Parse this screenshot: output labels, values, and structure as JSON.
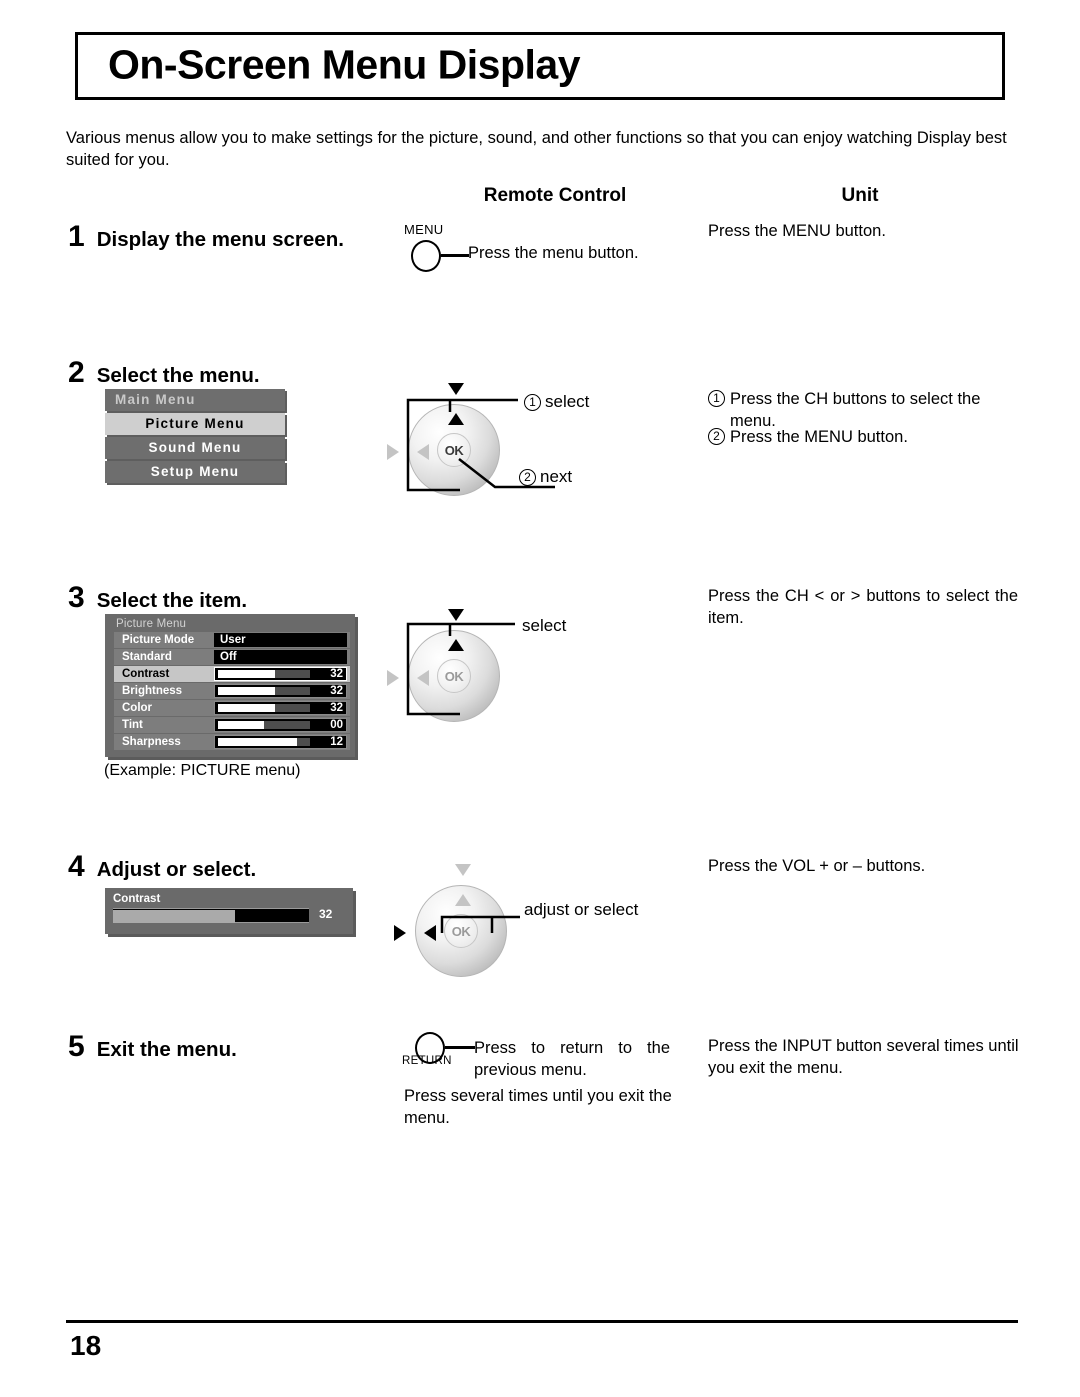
{
  "page": {
    "title": "On-Screen Menu Display",
    "intro": "Various menus allow you to make settings for the picture, sound, and other functions so that you can enjoy watching Display best suited for you.",
    "number": "18"
  },
  "columns": {
    "remote_control": "Remote Control",
    "unit": "Unit"
  },
  "steps": [
    {
      "number": "1",
      "title": "Display the menu screen.",
      "remote": {
        "button_label": "MENU",
        "instruction": "Press the menu button."
      },
      "unit": "Press the MENU button."
    },
    {
      "number": "2",
      "title": "Select the menu.",
      "remote": {
        "callout_1_num": "1",
        "callout_1_label": "select",
        "callout_2_num": "2",
        "callout_2_label": "next",
        "ok_label": "OK"
      },
      "unit_1_num": "1",
      "unit_1": "Press the CH buttons to select the menu.",
      "unit_2_num": "2",
      "unit_2": "Press the MENU button."
    },
    {
      "number": "3",
      "title": "Select the item.",
      "remote": {
        "callout_label": "select",
        "ok_label": "OK"
      },
      "unit": "Press the CH < or > buttons to select the item.",
      "caption": "(Example: PICTURE menu)"
    },
    {
      "number": "4",
      "title": "Adjust or select.",
      "remote": {
        "callout_label": "adjust or select",
        "ok_label": "OK"
      },
      "unit": "Press the VOL + or – buttons."
    },
    {
      "number": "5",
      "title": "Exit the menu.",
      "remote": {
        "button_label": "RETURN",
        "instruction": "Press to return to the previous menu.",
        "extra": "Press several times until you exit the menu."
      },
      "unit": "Press the INPUT button several times until you exit the menu."
    }
  ],
  "osd_main_menu": {
    "header": "Main Menu",
    "items": [
      {
        "label": "Picture Menu",
        "selected": true
      },
      {
        "label": "Sound Menu",
        "selected": false
      },
      {
        "label": "Setup Menu",
        "selected": false
      }
    ]
  },
  "osd_picture_menu": {
    "title": "Picture Menu",
    "rows": [
      {
        "label": "Picture Mode",
        "type": "text",
        "value": "User",
        "selected": false
      },
      {
        "label": "Standard",
        "type": "text",
        "value": "Off",
        "selected": false
      },
      {
        "label": "Contrast",
        "type": "slider",
        "value": "32",
        "fill_pct": 62,
        "selected": true
      },
      {
        "label": "Brightness",
        "type": "slider",
        "value": "32",
        "fill_pct": 62,
        "selected": false
      },
      {
        "label": "Color",
        "type": "slider",
        "value": "32",
        "fill_pct": 62,
        "selected": false
      },
      {
        "label": "Tint",
        "type": "slider",
        "value": "00",
        "fill_pct": 50,
        "selected": false
      },
      {
        "label": "Sharpness",
        "type": "slider",
        "value": "12",
        "fill_pct": 86,
        "selected": false
      }
    ]
  },
  "osd_contrast": {
    "label": "Contrast",
    "value": "32",
    "fill_pct": 62
  },
  "colors": {
    "osd_background": "#6a6a6a",
    "osd_row": "#7d7d7d",
    "osd_selected": "#c6c6c6",
    "osd_value_field": "#000000",
    "page_text": "#000000"
  }
}
